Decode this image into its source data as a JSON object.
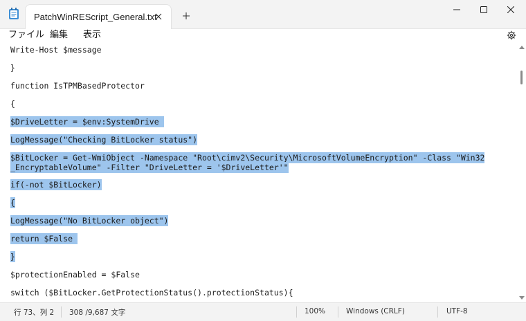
{
  "window": {
    "tab_title": "PatchWinREScript_General.txt",
    "app_icon": "notepad-icon",
    "new_tab_icon": "plus-icon",
    "controls": [
      "minimize-icon",
      "maximize-icon",
      "close-icon"
    ]
  },
  "menu": {
    "file": "ファイル",
    "edit": "編集",
    "view": "表示",
    "settings_icon": "gear-icon"
  },
  "editor": {
    "lines": [
      "Write-Host $message",
      "}",
      "function IsTPMBasedProtector",
      "{",
      "$DriveLetter = $env:SystemDrive ",
      "LogMessage(\"Checking BitLocker status\")",
      "$BitLocker = Get-WmiObject -Namespace \"Root\\cimv2\\Security\\MicrosoftVolumeEncryption\" -Class \"Win32",
      "_EncryptableVolume\" -Filter \"DriveLetter = '$DriveLetter'\"",
      "if(-not $BitLocker)",
      "{",
      "LogMessage(\"No BitLocker object\")",
      "return $False ",
      "}",
      "$protectionEnabled = $False",
      "switch ($BitLocker.GetProtectionStatus().protectionStatus){"
    ],
    "selection_color": "#9dc5ed"
  },
  "status": {
    "position": "行 73、列 2",
    "count": "308 /9,687 文字",
    "zoom": "100%",
    "line_ending": "Windows (CRLF)",
    "encoding": "UTF-8"
  }
}
